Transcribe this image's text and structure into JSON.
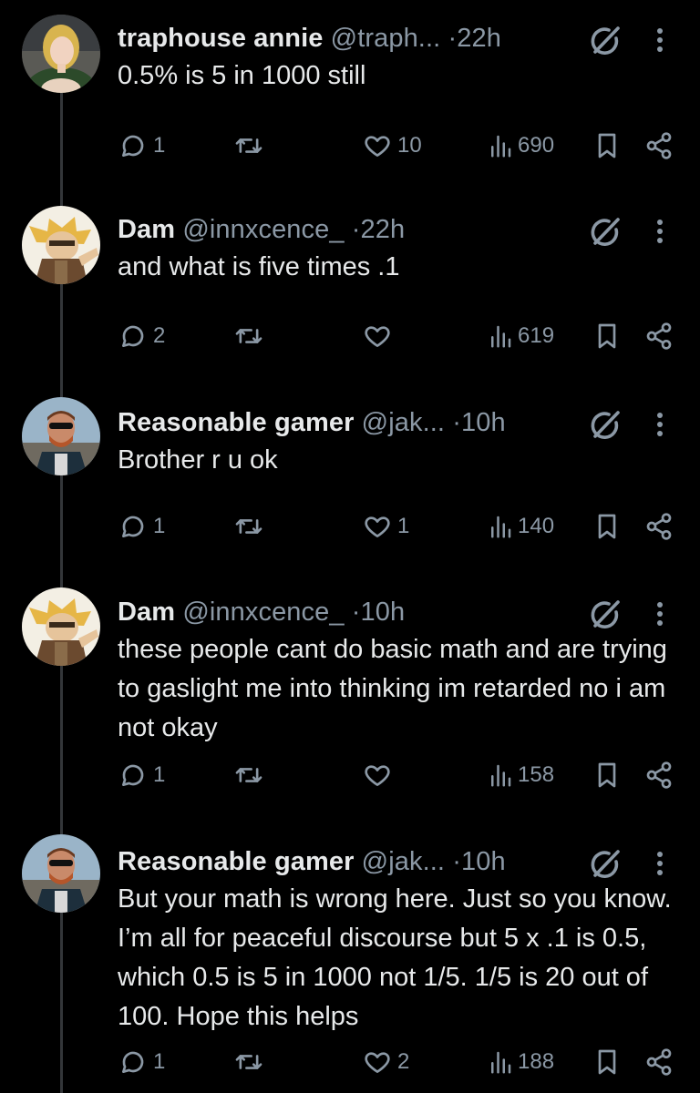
{
  "tweets": [
    {
      "display_name": "traphouse annie",
      "handle": "@traph...",
      "separator": "·",
      "time": "22h",
      "text": "0.5% is 5 in 1000 still",
      "replies": "1",
      "retweets": "",
      "likes": "10",
      "views": "690"
    },
    {
      "display_name": "Dam",
      "handle": "@innxcence_",
      "separator": "·",
      "time": "22h",
      "text": "and what is five times .1",
      "replies": "2",
      "retweets": "",
      "likes": "",
      "views": "619"
    },
    {
      "display_name": "Reasonable gamer",
      "handle": "@jak...",
      "separator": "·",
      "time": "10h",
      "text": "Brother r u ok",
      "replies": "1",
      "retweets": "",
      "likes": "1",
      "views": "140"
    },
    {
      "display_name": "Dam",
      "handle": "@innxcence_",
      "separator": "·",
      "time": "10h",
      "text": "these people cant do basic math and are trying to gaslight me into thinking im retarded no i am not okay",
      "replies": "1",
      "retweets": "",
      "likes": "",
      "views": "158"
    },
    {
      "display_name": "Reasonable gamer",
      "handle": "@jak...",
      "separator": "·",
      "time": "10h",
      "text": "But your math is wrong here. Just so you know. I’m all for peaceful discourse but 5 x .1 is 0.5, which 0.5 is 5 in 1000 not 1/5. 1/5 is 20 out of 100. Hope this helps",
      "replies": "1",
      "retweets": "",
      "likes": "2",
      "views": "188"
    }
  ],
  "icons": {
    "reply": "reply-icon",
    "retweet": "retweet-icon",
    "like": "heart-icon",
    "views": "views-icon",
    "bookmark": "bookmark-icon",
    "share": "share-icon",
    "grok": "grok-icon",
    "more": "more-icon"
  },
  "colors": {
    "background": "#000000",
    "text": "#e7e9ea",
    "secondary": "#8b98a5",
    "thread_line": "#333639"
  }
}
